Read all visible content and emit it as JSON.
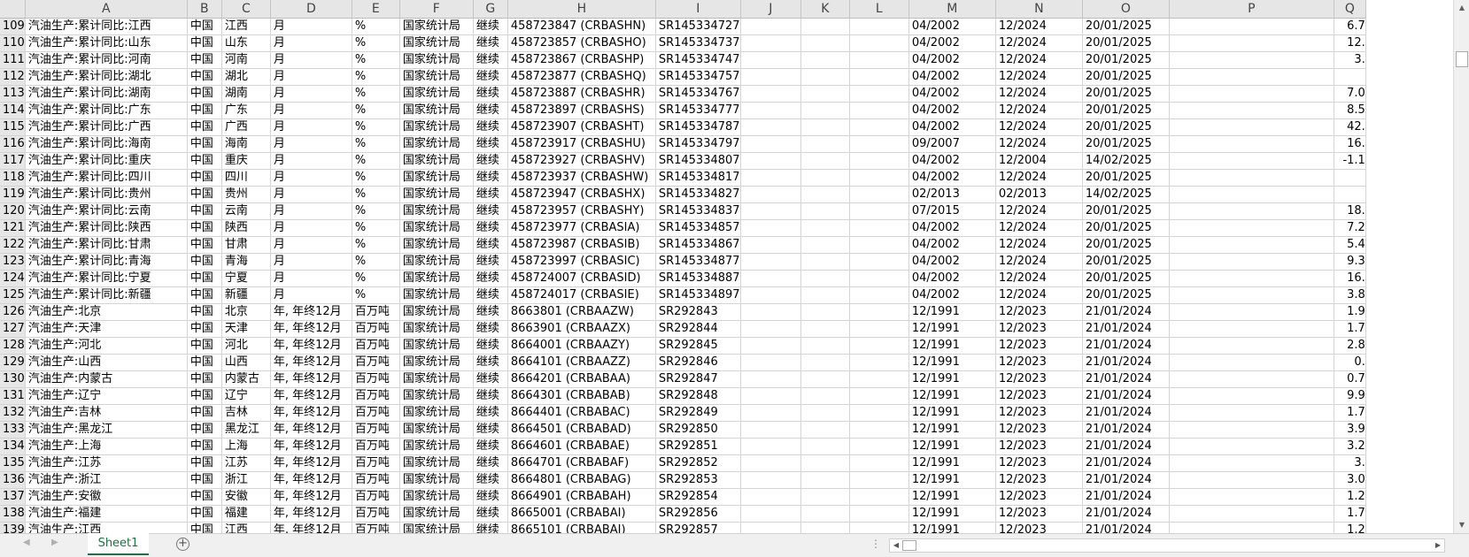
{
  "columns": [
    "A",
    "B",
    "C",
    "D",
    "E",
    "F",
    "G",
    "H",
    "I",
    "J",
    "K",
    "L",
    "M",
    "N",
    "O",
    "P",
    "Q"
  ],
  "rows": [
    {
      "n": "109",
      "A": "汽油生产:累计同比:江西",
      "B": "中国",
      "C": "江西",
      "D": "月",
      "E": "%",
      "F": "国家统计局",
      "G": "继续",
      "H": "458723847 (CRBASHN)",
      "I": "SR145334727",
      "M": "04/2002",
      "N": "12/2024",
      "O": "20/01/2025",
      "Q": "6.7"
    },
    {
      "n": "110",
      "A": "汽油生产:累计同比:山东",
      "B": "中国",
      "C": "山东",
      "D": "月",
      "E": "%",
      "F": "国家统计局",
      "G": "继续",
      "H": "458723857 (CRBASHO)",
      "I": "SR145334737",
      "M": "04/2002",
      "N": "12/2024",
      "O": "20/01/2025",
      "Q": "12."
    },
    {
      "n": "111",
      "A": "汽油生产:累计同比:河南",
      "B": "中国",
      "C": "河南",
      "D": "月",
      "E": "%",
      "F": "国家统计局",
      "G": "继续",
      "H": "458723867 (CRBASHP)",
      "I": "SR145334747",
      "M": "04/2002",
      "N": "12/2024",
      "O": "20/01/2025",
      "Q": "3."
    },
    {
      "n": "112",
      "A": "汽油生产:累计同比:湖北",
      "B": "中国",
      "C": "湖北",
      "D": "月",
      "E": "%",
      "F": "国家统计局",
      "G": "继续",
      "H": "458723877 (CRBASHQ)",
      "I": "SR145334757",
      "M": "04/2002",
      "N": "12/2024",
      "O": "20/01/2025",
      "Q": ""
    },
    {
      "n": "113",
      "A": "汽油生产:累计同比:湖南",
      "B": "中国",
      "C": "湖南",
      "D": "月",
      "E": "%",
      "F": "国家统计局",
      "G": "继续",
      "H": "458723887 (CRBASHR)",
      "I": "SR145334767",
      "M": "04/2002",
      "N": "12/2024",
      "O": "20/01/2025",
      "Q": "7.0"
    },
    {
      "n": "114",
      "A": "汽油生产:累计同比:广东",
      "B": "中国",
      "C": "广东",
      "D": "月",
      "E": "%",
      "F": "国家统计局",
      "G": "继续",
      "H": "458723897 (CRBASHS)",
      "I": "SR145334777",
      "M": "04/2002",
      "N": "12/2024",
      "O": "20/01/2025",
      "Q": "8.5"
    },
    {
      "n": "115",
      "A": "汽油生产:累计同比:广西",
      "B": "中国",
      "C": "广西",
      "D": "月",
      "E": "%",
      "F": "国家统计局",
      "G": "继续",
      "H": "458723907 (CRBASHT)",
      "I": "SR145334787",
      "M": "04/2002",
      "N": "12/2024",
      "O": "20/01/2025",
      "Q": "42."
    },
    {
      "n": "116",
      "A": "汽油生产:累计同比:海南",
      "B": "中国",
      "C": "海南",
      "D": "月",
      "E": "%",
      "F": "国家统计局",
      "G": "继续",
      "H": "458723917 (CRBASHU)",
      "I": "SR145334797",
      "M": "09/2007",
      "N": "12/2024",
      "O": "20/01/2025",
      "Q": "16."
    },
    {
      "n": "117",
      "A": "汽油生产:累计同比:重庆",
      "B": "中国",
      "C": "重庆",
      "D": "月",
      "E": "%",
      "F": "国家统计局",
      "G": "继续",
      "H": "458723927 (CRBASHV)",
      "I": "SR145334807",
      "M": "04/2002",
      "N": "12/2004",
      "O": "14/02/2025",
      "Q": "-1.1"
    },
    {
      "n": "118",
      "A": "汽油生产:累计同比:四川",
      "B": "中国",
      "C": "四川",
      "D": "月",
      "E": "%",
      "F": "国家统计局",
      "G": "继续",
      "H": "458723937 (CRBASHW)",
      "I": "SR145334817",
      "M": "04/2002",
      "N": "12/2024",
      "O": "20/01/2025",
      "Q": ""
    },
    {
      "n": "119",
      "A": "汽油生产:累计同比:贵州",
      "B": "中国",
      "C": "贵州",
      "D": "月",
      "E": "%",
      "F": "国家统计局",
      "G": "继续",
      "H": "458723947 (CRBASHX)",
      "I": "SR145334827",
      "M": "02/2013",
      "N": "02/2013",
      "O": "14/02/2025",
      "Q": ""
    },
    {
      "n": "120",
      "A": "汽油生产:累计同比:云南",
      "B": "中国",
      "C": "云南",
      "D": "月",
      "E": "%",
      "F": "国家统计局",
      "G": "继续",
      "H": "458723957 (CRBASHY)",
      "I": "SR145334837",
      "M": "07/2015",
      "N": "12/2024",
      "O": "20/01/2025",
      "Q": "18."
    },
    {
      "n": "121",
      "A": "汽油生产:累计同比:陕西",
      "B": "中国",
      "C": "陕西",
      "D": "月",
      "E": "%",
      "F": "国家统计局",
      "G": "继续",
      "H": "458723977 (CRBASIA)",
      "I": "SR145334857",
      "M": "04/2002",
      "N": "12/2024",
      "O": "20/01/2025",
      "Q": "7.2"
    },
    {
      "n": "122",
      "A": "汽油生产:累计同比:甘肃",
      "B": "中国",
      "C": "甘肃",
      "D": "月",
      "E": "%",
      "F": "国家统计局",
      "G": "继续",
      "H": "458723987 (CRBASIB)",
      "I": "SR145334867",
      "M": "04/2002",
      "N": "12/2024",
      "O": "20/01/2025",
      "Q": "5.4"
    },
    {
      "n": "123",
      "A": "汽油生产:累计同比:青海",
      "B": "中国",
      "C": "青海",
      "D": "月",
      "E": "%",
      "F": "国家统计局",
      "G": "继续",
      "H": "458723997 (CRBASIC)",
      "I": "SR145334877",
      "M": "04/2002",
      "N": "12/2024",
      "O": "20/01/2025",
      "Q": "9.3"
    },
    {
      "n": "124",
      "A": "汽油生产:累计同比:宁夏",
      "B": "中国",
      "C": "宁夏",
      "D": "月",
      "E": "%",
      "F": "国家统计局",
      "G": "继续",
      "H": "458724007 (CRBASID)",
      "I": "SR145334887",
      "M": "04/2002",
      "N": "12/2024",
      "O": "20/01/2025",
      "Q": "16."
    },
    {
      "n": "125",
      "A": "汽油生产:累计同比:新疆",
      "B": "中国",
      "C": "新疆",
      "D": "月",
      "E": "%",
      "F": "国家统计局",
      "G": "继续",
      "H": "458724017 (CRBASIE)",
      "I": "SR145334897",
      "M": "04/2002",
      "N": "12/2024",
      "O": "20/01/2025",
      "Q": "3.8"
    },
    {
      "n": "126",
      "A": "汽油生产:北京",
      "B": "中国",
      "C": "北京",
      "D": "年, 年终12月",
      "E": "百万吨",
      "F": "国家统计局",
      "G": "继续",
      "H": "8663801 (CRBAAZW)",
      "I": "SR292843",
      "M": "12/1991",
      "N": "12/2023",
      "O": "21/01/2024",
      "Q": "1.9"
    },
    {
      "n": "127",
      "A": "汽油生产:天津",
      "B": "中国",
      "C": "天津",
      "D": "年, 年终12月",
      "E": "百万吨",
      "F": "国家统计局",
      "G": "继续",
      "H": "8663901 (CRBAAZX)",
      "I": "SR292844",
      "M": "12/1991",
      "N": "12/2023",
      "O": "21/01/2024",
      "Q": "1.7"
    },
    {
      "n": "128",
      "A": "汽油生产:河北",
      "B": "中国",
      "C": "河北",
      "D": "年, 年终12月",
      "E": "百万吨",
      "F": "国家统计局",
      "G": "继续",
      "H": "8664001 (CRBAAZY)",
      "I": "SR292845",
      "M": "12/1991",
      "N": "12/2023",
      "O": "21/01/2024",
      "Q": "2.8"
    },
    {
      "n": "129",
      "A": "汽油生产:山西",
      "B": "中国",
      "C": "山西",
      "D": "年, 年终12月",
      "E": "百万吨",
      "F": "国家统计局",
      "G": "继续",
      "H": "8664101 (CRBAAZZ)",
      "I": "SR292846",
      "M": "12/1991",
      "N": "12/2023",
      "O": "21/01/2024",
      "Q": "0."
    },
    {
      "n": "130",
      "A": "汽油生产:内蒙古",
      "B": "中国",
      "C": "内蒙古",
      "D": "年, 年终12月",
      "E": "百万吨",
      "F": "国家统计局",
      "G": "继续",
      "H": "8664201 (CRBABAA)",
      "I": "SR292847",
      "M": "12/1991",
      "N": "12/2023",
      "O": "21/01/2024",
      "Q": "0.7"
    },
    {
      "n": "131",
      "A": "汽油生产:辽宁",
      "B": "中国",
      "C": "辽宁",
      "D": "年, 年终12月",
      "E": "百万吨",
      "F": "国家统计局",
      "G": "继续",
      "H": "8664301 (CRBABAB)",
      "I": "SR292848",
      "M": "12/1991",
      "N": "12/2023",
      "O": "21/01/2024",
      "Q": "9.9"
    },
    {
      "n": "132",
      "A": "汽油生产:吉林",
      "B": "中国",
      "C": "吉林",
      "D": "年, 年终12月",
      "E": "百万吨",
      "F": "国家统计局",
      "G": "继续",
      "H": "8664401 (CRBABAC)",
      "I": "SR292849",
      "M": "12/1991",
      "N": "12/2023",
      "O": "21/01/2024",
      "Q": "1.7"
    },
    {
      "n": "133",
      "A": "汽油生产:黑龙江",
      "B": "中国",
      "C": "黑龙江",
      "D": "年, 年终12月",
      "E": "百万吨",
      "F": "国家统计局",
      "G": "继续",
      "H": "8664501 (CRBABAD)",
      "I": "SR292850",
      "M": "12/1991",
      "N": "12/2023",
      "O": "21/01/2024",
      "Q": "3.9"
    },
    {
      "n": "134",
      "A": "汽油生产:上海",
      "B": "中国",
      "C": "上海",
      "D": "年, 年终12月",
      "E": "百万吨",
      "F": "国家统计局",
      "G": "继续",
      "H": "8664601 (CRBABAE)",
      "I": "SR292851",
      "M": "12/1991",
      "N": "12/2023",
      "O": "21/01/2024",
      "Q": "3.2"
    },
    {
      "n": "135",
      "A": "汽油生产:江苏",
      "B": "中国",
      "C": "江苏",
      "D": "年, 年终12月",
      "E": "百万吨",
      "F": "国家统计局",
      "G": "继续",
      "H": "8664701 (CRBABAF)",
      "I": "SR292852",
      "M": "12/1991",
      "N": "12/2023",
      "O": "21/01/2024",
      "Q": "3."
    },
    {
      "n": "136",
      "A": "汽油生产:浙江",
      "B": "中国",
      "C": "浙江",
      "D": "年, 年终12月",
      "E": "百万吨",
      "F": "国家统计局",
      "G": "继续",
      "H": "8664801 (CRBABAG)",
      "I": "SR292853",
      "M": "12/1991",
      "N": "12/2023",
      "O": "21/01/2024",
      "Q": "3.0"
    },
    {
      "n": "137",
      "A": "汽油生产:安徽",
      "B": "中国",
      "C": "安徽",
      "D": "年, 年终12月",
      "E": "百万吨",
      "F": "国家统计局",
      "G": "继续",
      "H": "8664901 (CRBABAH)",
      "I": "SR292854",
      "M": "12/1991",
      "N": "12/2023",
      "O": "21/01/2024",
      "Q": "1.2"
    },
    {
      "n": "138",
      "A": "汽油生产:福建",
      "B": "中国",
      "C": "福建",
      "D": "年, 年终12月",
      "E": "百万吨",
      "F": "国家统计局",
      "G": "继续",
      "H": "8665001 (CRBABAI)",
      "I": "SR292856",
      "M": "12/1991",
      "N": "12/2023",
      "O": "21/01/2024",
      "Q": "1.7"
    },
    {
      "n": "139",
      "A": "汽油生产:江西",
      "B": "中国",
      "C": "江西",
      "D": "年, 年终12月",
      "E": "百万吨",
      "F": "国家统计局",
      "G": "继续",
      "H": "8665101 (CRBABAJ)",
      "I": "SR292857",
      "M": "12/1991",
      "N": "12/2023",
      "O": "21/01/2024",
      "Q": "1.2"
    }
  ],
  "sheet_tabs": [
    {
      "label": "Sheet1",
      "active": true
    }
  ],
  "controls": {
    "add_sheet_symbol": "+",
    "split_dots": "⋮",
    "prev_sheet": "◀",
    "next_sheet": "▶",
    "scroll_up": "▲",
    "scroll_down": "▼",
    "scroll_left": "◀",
    "scroll_right": "▶"
  },
  "colors": {
    "active_tab": "#1e7145",
    "header_bg": "#e6e6e6",
    "gridline": "#d4d4d4"
  }
}
